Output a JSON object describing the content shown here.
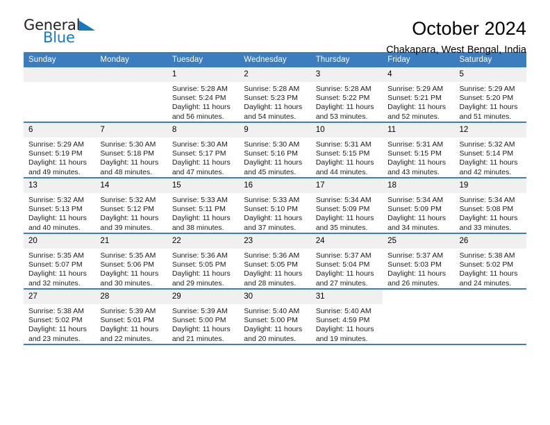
{
  "logo": {
    "word_one": "General",
    "word_two": "Blue",
    "triangle": "blue-triangle",
    "accent_color": "#1878be"
  },
  "header": {
    "title": "October 2024",
    "subtitle": "Chakapara, West Bengal, India"
  },
  "theme": {
    "header_blue": "#3b7dbf",
    "daynum_gray": "#f0f0f0"
  },
  "weekday_headers": [
    "Sunday",
    "Monday",
    "Tuesday",
    "Wednesday",
    "Thursday",
    "Friday",
    "Saturday"
  ],
  "labels": {
    "sunrise": "Sunrise:",
    "sunset": "Sunset:",
    "daylight": "Daylight:"
  },
  "weeks": [
    [
      {
        "day": "",
        "empty": true
      },
      {
        "day": "",
        "empty": true
      },
      {
        "day": "1",
        "sunrise": "Sunrise: 5:28 AM",
        "sunset": "Sunset: 5:24 PM",
        "daylight1": "Daylight: 11 hours",
        "daylight2": "and 56 minutes."
      },
      {
        "day": "2",
        "sunrise": "Sunrise: 5:28 AM",
        "sunset": "Sunset: 5:23 PM",
        "daylight1": "Daylight: 11 hours",
        "daylight2": "and 54 minutes."
      },
      {
        "day": "3",
        "sunrise": "Sunrise: 5:28 AM",
        "sunset": "Sunset: 5:22 PM",
        "daylight1": "Daylight: 11 hours",
        "daylight2": "and 53 minutes."
      },
      {
        "day": "4",
        "sunrise": "Sunrise: 5:29 AM",
        "sunset": "Sunset: 5:21 PM",
        "daylight1": "Daylight: 11 hours",
        "daylight2": "and 52 minutes."
      },
      {
        "day": "5",
        "sunrise": "Sunrise: 5:29 AM",
        "sunset": "Sunset: 5:20 PM",
        "daylight1": "Daylight: 11 hours",
        "daylight2": "and 51 minutes."
      }
    ],
    [
      {
        "day": "6",
        "sunrise": "Sunrise: 5:29 AM",
        "sunset": "Sunset: 5:19 PM",
        "daylight1": "Daylight: 11 hours",
        "daylight2": "and 49 minutes."
      },
      {
        "day": "7",
        "sunrise": "Sunrise: 5:30 AM",
        "sunset": "Sunset: 5:18 PM",
        "daylight1": "Daylight: 11 hours",
        "daylight2": "and 48 minutes."
      },
      {
        "day": "8",
        "sunrise": "Sunrise: 5:30 AM",
        "sunset": "Sunset: 5:17 PM",
        "daylight1": "Daylight: 11 hours",
        "daylight2": "and 47 minutes."
      },
      {
        "day": "9",
        "sunrise": "Sunrise: 5:30 AM",
        "sunset": "Sunset: 5:16 PM",
        "daylight1": "Daylight: 11 hours",
        "daylight2": "and 45 minutes."
      },
      {
        "day": "10",
        "sunrise": "Sunrise: 5:31 AM",
        "sunset": "Sunset: 5:15 PM",
        "daylight1": "Daylight: 11 hours",
        "daylight2": "and 44 minutes."
      },
      {
        "day": "11",
        "sunrise": "Sunrise: 5:31 AM",
        "sunset": "Sunset: 5:15 PM",
        "daylight1": "Daylight: 11 hours",
        "daylight2": "and 43 minutes."
      },
      {
        "day": "12",
        "sunrise": "Sunrise: 5:32 AM",
        "sunset": "Sunset: 5:14 PM",
        "daylight1": "Daylight: 11 hours",
        "daylight2": "and 42 minutes."
      }
    ],
    [
      {
        "day": "13",
        "sunrise": "Sunrise: 5:32 AM",
        "sunset": "Sunset: 5:13 PM",
        "daylight1": "Daylight: 11 hours",
        "daylight2": "and 40 minutes."
      },
      {
        "day": "14",
        "sunrise": "Sunrise: 5:32 AM",
        "sunset": "Sunset: 5:12 PM",
        "daylight1": "Daylight: 11 hours",
        "daylight2": "and 39 minutes."
      },
      {
        "day": "15",
        "sunrise": "Sunrise: 5:33 AM",
        "sunset": "Sunset: 5:11 PM",
        "daylight1": "Daylight: 11 hours",
        "daylight2": "and 38 minutes."
      },
      {
        "day": "16",
        "sunrise": "Sunrise: 5:33 AM",
        "sunset": "Sunset: 5:10 PM",
        "daylight1": "Daylight: 11 hours",
        "daylight2": "and 37 minutes."
      },
      {
        "day": "17",
        "sunrise": "Sunrise: 5:34 AM",
        "sunset": "Sunset: 5:09 PM",
        "daylight1": "Daylight: 11 hours",
        "daylight2": "and 35 minutes."
      },
      {
        "day": "18",
        "sunrise": "Sunrise: 5:34 AM",
        "sunset": "Sunset: 5:09 PM",
        "daylight1": "Daylight: 11 hours",
        "daylight2": "and 34 minutes."
      },
      {
        "day": "19",
        "sunrise": "Sunrise: 5:34 AM",
        "sunset": "Sunset: 5:08 PM",
        "daylight1": "Daylight: 11 hours",
        "daylight2": "and 33 minutes."
      }
    ],
    [
      {
        "day": "20",
        "sunrise": "Sunrise: 5:35 AM",
        "sunset": "Sunset: 5:07 PM",
        "daylight1": "Daylight: 11 hours",
        "daylight2": "and 32 minutes."
      },
      {
        "day": "21",
        "sunrise": "Sunrise: 5:35 AM",
        "sunset": "Sunset: 5:06 PM",
        "daylight1": "Daylight: 11 hours",
        "daylight2": "and 30 minutes."
      },
      {
        "day": "22",
        "sunrise": "Sunrise: 5:36 AM",
        "sunset": "Sunset: 5:05 PM",
        "daylight1": "Daylight: 11 hours",
        "daylight2": "and 29 minutes."
      },
      {
        "day": "23",
        "sunrise": "Sunrise: 5:36 AM",
        "sunset": "Sunset: 5:05 PM",
        "daylight1": "Daylight: 11 hours",
        "daylight2": "and 28 minutes."
      },
      {
        "day": "24",
        "sunrise": "Sunrise: 5:37 AM",
        "sunset": "Sunset: 5:04 PM",
        "daylight1": "Daylight: 11 hours",
        "daylight2": "and 27 minutes."
      },
      {
        "day": "25",
        "sunrise": "Sunrise: 5:37 AM",
        "sunset": "Sunset: 5:03 PM",
        "daylight1": "Daylight: 11 hours",
        "daylight2": "and 26 minutes."
      },
      {
        "day": "26",
        "sunrise": "Sunrise: 5:38 AM",
        "sunset": "Sunset: 5:02 PM",
        "daylight1": "Daylight: 11 hours",
        "daylight2": "and 24 minutes."
      }
    ],
    [
      {
        "day": "27",
        "sunrise": "Sunrise: 5:38 AM",
        "sunset": "Sunset: 5:02 PM",
        "daylight1": "Daylight: 11 hours",
        "daylight2": "and 23 minutes."
      },
      {
        "day": "28",
        "sunrise": "Sunrise: 5:39 AM",
        "sunset": "Sunset: 5:01 PM",
        "daylight1": "Daylight: 11 hours",
        "daylight2": "and 22 minutes."
      },
      {
        "day": "29",
        "sunrise": "Sunrise: 5:39 AM",
        "sunset": "Sunset: 5:00 PM",
        "daylight1": "Daylight: 11 hours",
        "daylight2": "and 21 minutes."
      },
      {
        "day": "30",
        "sunrise": "Sunrise: 5:40 AM",
        "sunset": "Sunset: 5:00 PM",
        "daylight1": "Daylight: 11 hours",
        "daylight2": "and 20 minutes."
      },
      {
        "day": "31",
        "sunrise": "Sunrise: 5:40 AM",
        "sunset": "Sunset: 4:59 PM",
        "daylight1": "Daylight: 11 hours",
        "daylight2": "and 19 minutes."
      },
      {
        "day": "",
        "blank": true
      },
      {
        "day": "",
        "blank": true
      }
    ]
  ]
}
